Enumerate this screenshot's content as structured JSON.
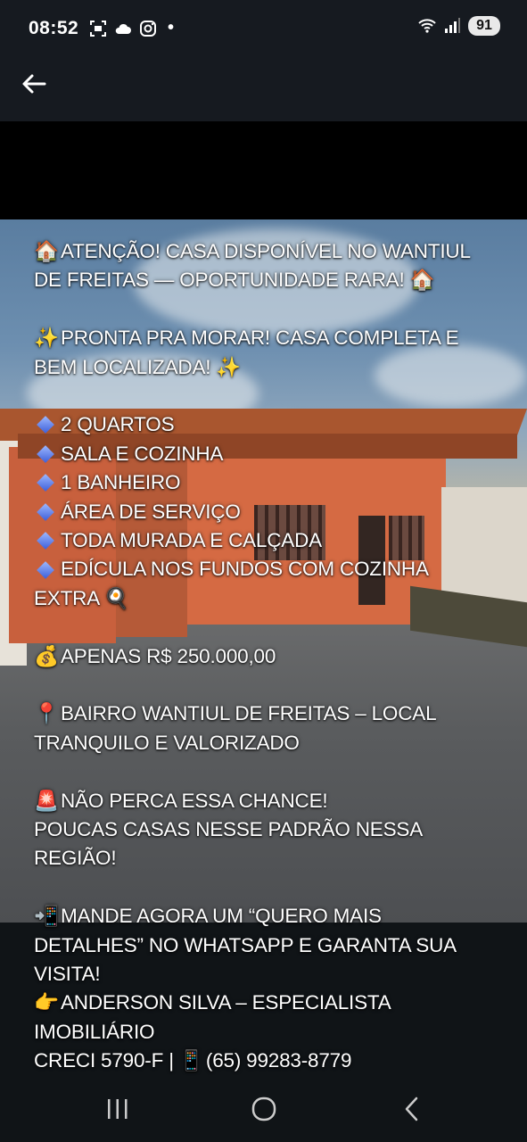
{
  "status_bar": {
    "time": "08:52",
    "battery": "91",
    "notification_dot": "•"
  },
  "app_bar": {
    "back_icon": "arrow-left-icon"
  },
  "post": {
    "headline_1": "ATENÇÃO! CASA DISPONÍVEL NO WANTIUL",
    "headline_2": "DE FREITAS — OPORTUNIDADE RARA!",
    "ready_1": "PRONTA PRA MORAR! CASA COMPLETA E",
    "ready_2": "BEM LOCALIZADA!",
    "features": [
      "2 QUARTOS",
      "SALA E COZINHA",
      "1 BANHEIRO",
      "ÁREA DE SERVIÇO",
      "TODA MURADA E CALÇADA",
      "EDÍCULA NOS FUNDOS COM COZINHA"
    ],
    "feature_cont": "EXTRA",
    "price": "APENAS R$ 250.000,00",
    "location_1": "BAIRRO WANTIUL DE FREITAS – LOCAL",
    "location_2": "TRANQUILO E VALORIZADO",
    "chance_1": "NÃO PERCA ESSA CHANCE!",
    "chance_2": "POUCAS CASAS NESSE PADRÃO NESSA",
    "chance_3": "REGIÃO!",
    "cta_1": "MANDE AGORA UM “QUERO MAIS",
    "cta_2": "DETALHES” NO WHATSAPP E GARANTA SUA",
    "cta_3": "VISITA!",
    "agent_1": "ANDERSON SILVA – ESPECIALISTA",
    "agent_2": "IMOBILIÁRIO",
    "creci": "CRECI 5790-F |",
    "phone": "(65) 99283-8779"
  },
  "emoji": {
    "house": "🏠",
    "sparkles": "✨",
    "money": "💰",
    "pin": "📍",
    "siren": "🚨",
    "phone_arrow": "📲",
    "pointing": "👉",
    "mobile": "📱",
    "egg": "🍳"
  },
  "icons": [
    "arrow-left-icon",
    "screenshot-icon",
    "cloud-icon",
    "instagram-icon",
    "wifi-icon",
    "signal-icon",
    "recents-icon",
    "home-icon",
    "back-icon"
  ]
}
